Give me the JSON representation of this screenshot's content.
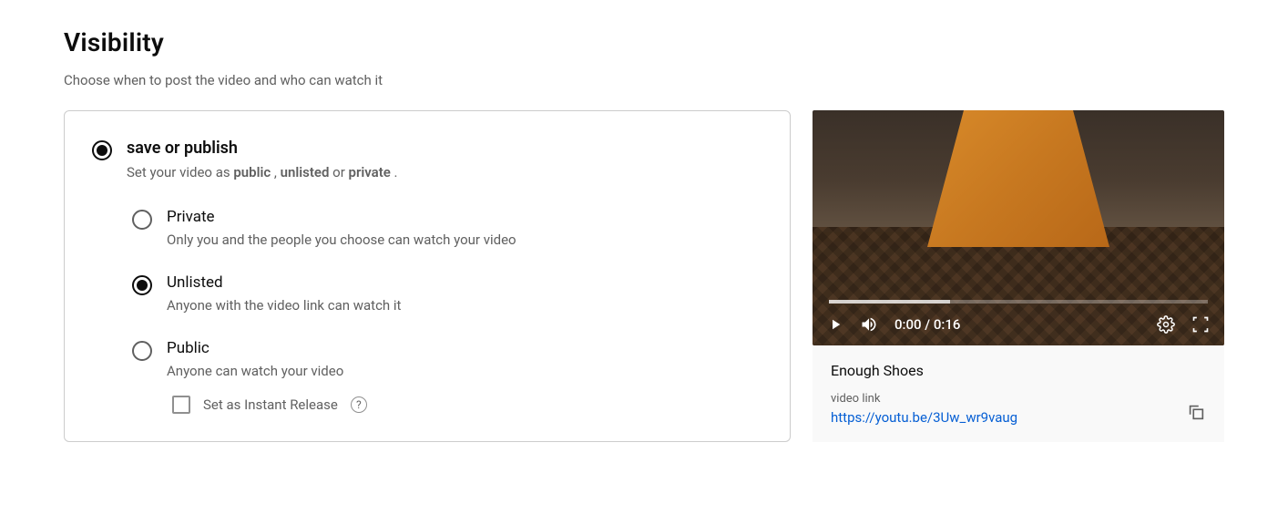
{
  "page": {
    "title": "Visibility",
    "subtitle": "Choose when to post the video and who can watch it"
  },
  "saveOrPublish": {
    "title": "save or publish",
    "descPrefix": "Set your video as ",
    "descBold1": "public",
    "descSep1": " , ",
    "descBold2": "unlisted",
    "descSep2": " or ",
    "descBold3": "private",
    "descSuffix": " ."
  },
  "options": {
    "private": {
      "label": "Private",
      "desc": "Only you and the people you choose can watch your video"
    },
    "unlisted": {
      "label": "Unlisted",
      "desc": "Anyone with the video link can watch it"
    },
    "public": {
      "label": "Public",
      "desc": "Anyone can watch your video"
    }
  },
  "instant": {
    "label": "Set as Instant Release"
  },
  "player": {
    "time": "0:00 / 0:16"
  },
  "video": {
    "title": "Enough Shoes",
    "linkLabel": "video link",
    "linkUrl": "https://youtu.be/3Uw_wr9vaug"
  }
}
